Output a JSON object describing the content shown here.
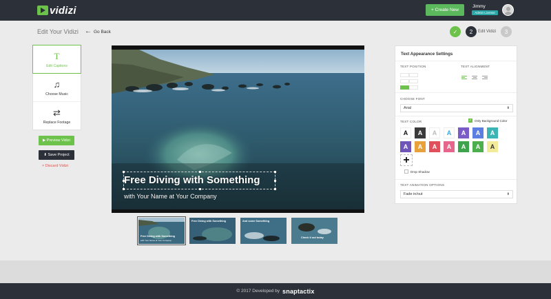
{
  "app": {
    "logo_text": "vidizi"
  },
  "topbar": {
    "create_label": "+ Create New",
    "user_name": "Jimmy",
    "user_badge": "Admin License"
  },
  "header": {
    "title": "Edit Your Vidizi",
    "back_label": "Go Back"
  },
  "steps": [
    {
      "label": "✓",
      "status": "done"
    },
    {
      "label": "2",
      "status": "current",
      "caption": "Edit Vidizi"
    },
    {
      "label": "3",
      "status": "upcoming"
    }
  ],
  "sidebar": {
    "items": [
      {
        "icon": "text-icon",
        "glyph": "T",
        "label": "Edit Captions",
        "active": true
      },
      {
        "icon": "music-icon",
        "glyph": "♫",
        "label": "Choose Music",
        "active": false
      },
      {
        "icon": "replace-icon",
        "glyph": "⇄",
        "label": "Replace Footage",
        "active": false
      }
    ],
    "preview_label": "▶ Preview Vidizi",
    "save_label": "⬇ Save Project",
    "discard_label": "× Discard Vidizi"
  },
  "video": {
    "caption_title": "Free Diving with Something",
    "caption_subtitle": "with Your Name at Your Company"
  },
  "thumbnails": [
    {
      "title": "Free Diving with Something",
      "subtitle": "with Your Name at Your Company",
      "selected": true
    },
    {
      "title": "Free Diving with Something",
      "subtitle": "",
      "selected": false
    },
    {
      "title": "And some Something",
      "subtitle": "",
      "selected": false
    },
    {
      "title": "Check it out today",
      "subtitle": "",
      "selected": false
    }
  ],
  "settings": {
    "title": "Text Appearance Settings",
    "text_position_label": "Text Position",
    "text_alignment_label": "Text Alignment",
    "choose_font_label": "Choose Font",
    "font_value": "Arial",
    "text_color_label": "Text Color",
    "only_bg_label": "Only Background Color",
    "only_bg_checked": true,
    "drop_shadow_label": "Drop Shadow",
    "drop_shadow_checked": false,
    "animation_label": "Text Animation Options",
    "animation_value": "Fade in/out",
    "swatch_letter": "A",
    "swatches_row1": [
      {
        "bg": "#ffffff",
        "fg": "#111111"
      },
      {
        "bg": "#3a3a3a",
        "fg": "#ffffff"
      },
      {
        "bg": "#ffffff",
        "fg": "#bbbbbb"
      },
      {
        "bg": "#ffffff",
        "fg": "#39a9dc"
      },
      {
        "bg": "#7b5cc7",
        "fg": "#ffffff"
      },
      {
        "bg": "#5b7ee0",
        "fg": "#ffffff"
      },
      {
        "bg": "#3cb4b4",
        "fg": "#ffffff"
      }
    ],
    "swatches_row2": [
      {
        "bg": "#6f55b8",
        "fg": "#ffffff"
      },
      {
        "bg": "#e9a23b",
        "fg": "#ffffff"
      },
      {
        "bg": "#e14f5c",
        "fg": "#ffffff"
      },
      {
        "bg": "#e6658c",
        "fg": "#ffffff"
      },
      {
        "bg": "#3da34d",
        "fg": "#ffffff"
      },
      {
        "bg": "#4cae4c",
        "fg": "#ffffff"
      },
      {
        "bg": "#f2ec9a",
        "fg": "#333333"
      }
    ]
  },
  "footer": {
    "text": "© 2017 Developed by",
    "brand": "snaptactix"
  },
  "colors": {
    "accent": "#6cc24a",
    "dark": "#2c3039",
    "danger": "#d9534f"
  }
}
